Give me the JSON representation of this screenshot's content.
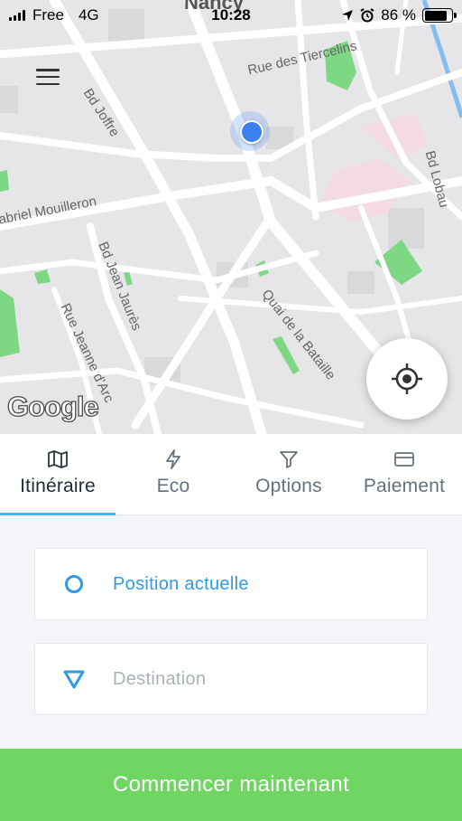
{
  "status_bar": {
    "carrier": "Free",
    "network": "4G",
    "time": "10:28",
    "battery_percent": "86 %",
    "battery_level": 0.86
  },
  "map": {
    "city": "Nancy",
    "streets": [
      "Rue des Tiercelins",
      "Bd Joffre",
      "Bd Lobau",
      "abriel Mouilleron",
      "Bd Jean Jaurès",
      "Rue Jeanne d'Arc",
      "Quai de la Bataille"
    ],
    "attribution": "Google"
  },
  "tabs": [
    {
      "label": "Itinéraire",
      "icon": "map-icon",
      "active": true
    },
    {
      "label": "Eco",
      "icon": "lightning-icon",
      "active": false
    },
    {
      "label": "Options",
      "icon": "filter-icon",
      "active": false
    },
    {
      "label": "Paiement",
      "icon": "card-icon",
      "active": false
    }
  ],
  "form": {
    "origin_value": "Position actuelle",
    "destination_placeholder": "Destination"
  },
  "cta": {
    "label": "Commencer maintenant"
  },
  "colors": {
    "accent": "#2bc3e8",
    "origin_blue": "#2e9be3",
    "cta_green": "#71d563",
    "park_green": "#7ed883"
  }
}
